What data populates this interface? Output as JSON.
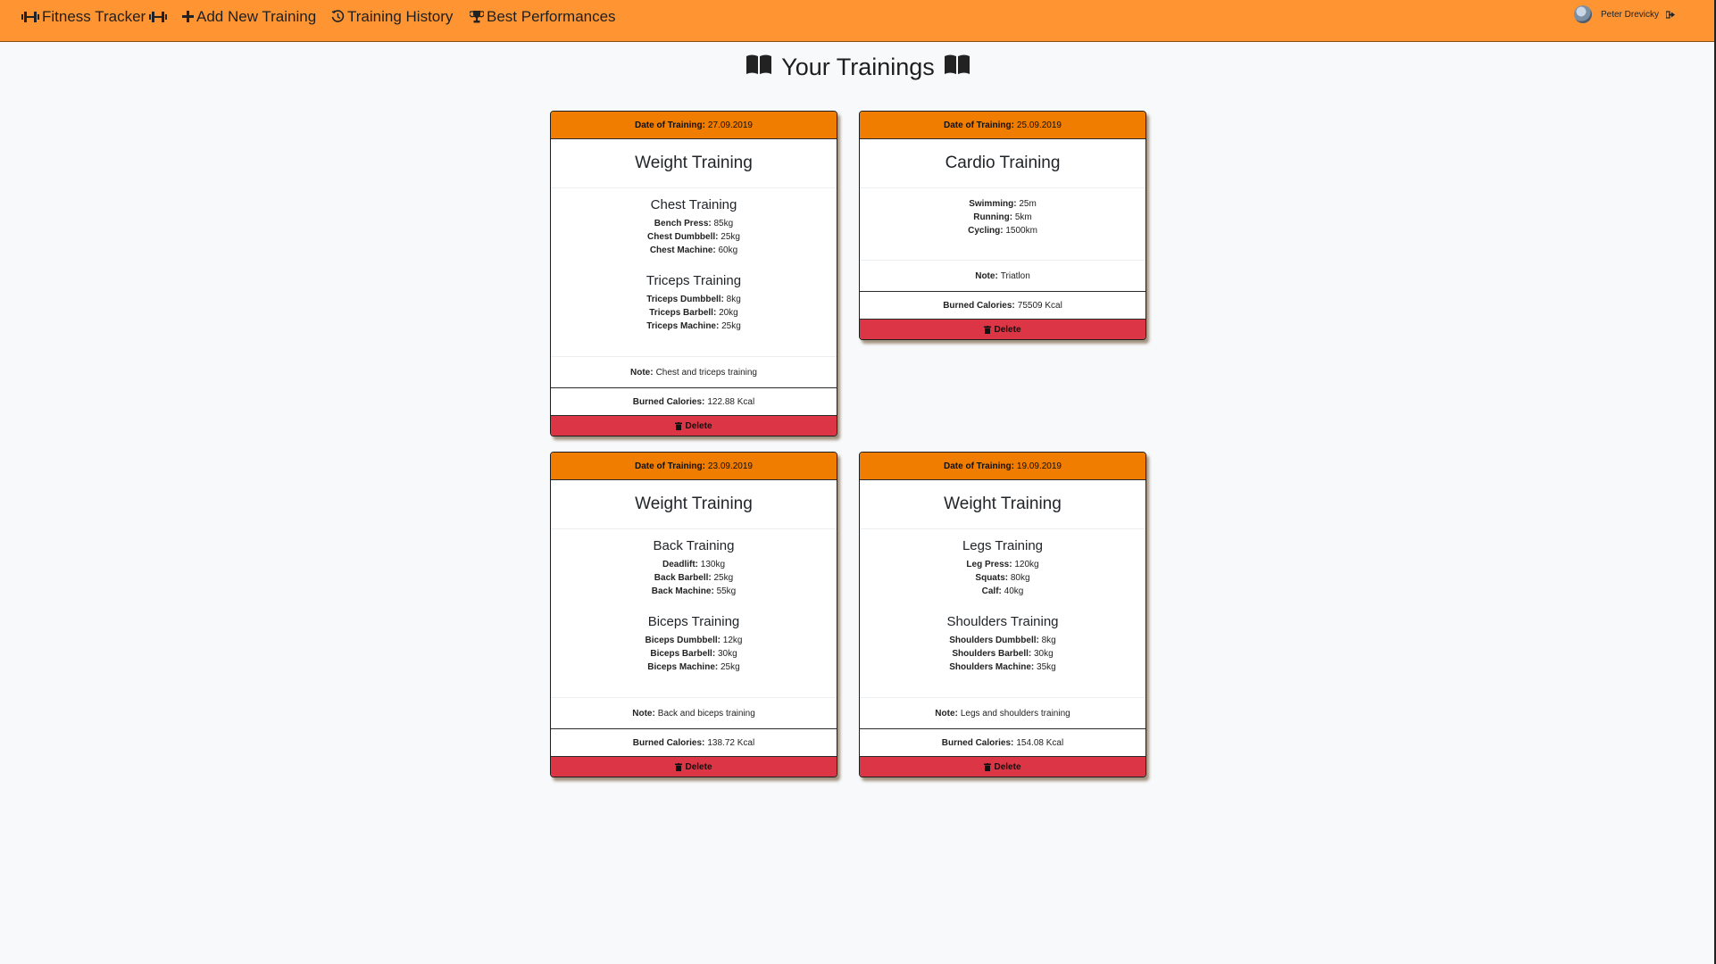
{
  "nav": {
    "brand": "Fitness Tracker",
    "add": "Add New Training",
    "history": "Training History",
    "best": "Best Performances",
    "user": "Peter Drevicky"
  },
  "page": {
    "title": "Your Trainings"
  },
  "labels": {
    "date": "Date of Training:",
    "note": "Note:",
    "calories": "Burned Calories:",
    "delete": "Delete"
  },
  "cards": [
    {
      "date": "27.09.2019",
      "type": "Weight Training",
      "groups": [
        {
          "title": "Chest Training",
          "exercises": [
            {
              "name": "Bench Press:",
              "value": "85kg"
            },
            {
              "name": "Chest Dumbbell:",
              "value": "25kg"
            },
            {
              "name": "Chest Machine:",
              "value": "60kg"
            }
          ]
        },
        {
          "title": "Triceps Training",
          "exercises": [
            {
              "name": "Triceps Dumbbell:",
              "value": "8kg"
            },
            {
              "name": "Triceps Barbell:",
              "value": "20kg"
            },
            {
              "name": "Triceps Machine:",
              "value": "25kg"
            }
          ]
        }
      ],
      "note": "Chest and triceps training",
      "calories": "122.88 Kcal"
    },
    {
      "date": "25.09.2019",
      "type": "Cardio Training",
      "exercises": [
        {
          "name": "Swimming:",
          "value": "25m"
        },
        {
          "name": "Running:",
          "value": "5km"
        },
        {
          "name": "Cycling:",
          "value": "1500km"
        }
      ],
      "note": "Triatlon",
      "calories": "75509 Kcal"
    },
    {
      "date": "23.09.2019",
      "type": "Weight Training",
      "groups": [
        {
          "title": "Back Training",
          "exercises": [
            {
              "name": "Deadlift:",
              "value": "130kg"
            },
            {
              "name": "Back Barbell:",
              "value": "25kg"
            },
            {
              "name": "Back Machine:",
              "value": "55kg"
            }
          ]
        },
        {
          "title": "Biceps Training",
          "exercises": [
            {
              "name": "Biceps Dumbbell:",
              "value": "12kg"
            },
            {
              "name": "Biceps Barbell:",
              "value": "30kg"
            },
            {
              "name": "Biceps Machine:",
              "value": "25kg"
            }
          ]
        }
      ],
      "note": "Back and biceps training",
      "calories": "138.72 Kcal"
    },
    {
      "date": "19.09.2019",
      "type": "Weight Training",
      "groups": [
        {
          "title": "Legs Training",
          "exercises": [
            {
              "name": "Leg Press:",
              "value": "120kg"
            },
            {
              "name": "Squats:",
              "value": "80kg"
            },
            {
              "name": "Calf:",
              "value": "40kg"
            }
          ]
        },
        {
          "title": "Shoulders Training",
          "exercises": [
            {
              "name": "Shoulders Dumbbell:",
              "value": "8kg"
            },
            {
              "name": "Shoulders Barbell:",
              "value": "30kg"
            },
            {
              "name": "Shoulders Machine:",
              "value": "35kg"
            }
          ]
        }
      ],
      "note": "Legs and shoulders training",
      "calories": "154.08 Kcal"
    }
  ]
}
